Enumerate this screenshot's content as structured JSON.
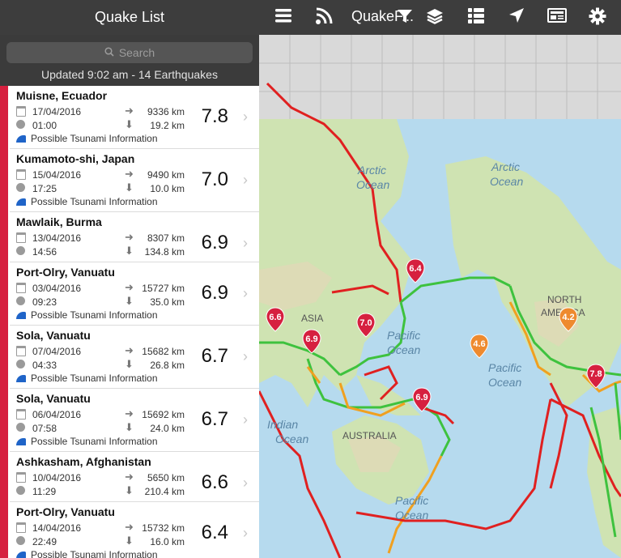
{
  "panel": {
    "title": "Quake List",
    "search_placeholder": "Search",
    "updated": "Updated 9:02 am - 14 Earthquakes"
  },
  "toolbar": {
    "title": "QuakeF...",
    "icons": [
      "menu-icon",
      "rss-icon",
      "filter-icon",
      "layers-icon",
      "list-icon",
      "location-arrow-icon",
      "news-icon",
      "gear-icon"
    ]
  },
  "quakes": [
    {
      "place": "Muisne, Ecuador",
      "date": "17/04/2016",
      "time": "01:00",
      "distance": "9336 km",
      "depth": "19.2 km",
      "magnitude": "7.8",
      "tsunami": "Possible Tsunami Information"
    },
    {
      "place": "Kumamoto-shi, Japan",
      "date": "15/04/2016",
      "time": "17:25",
      "distance": "9490 km",
      "depth": "10.0 km",
      "magnitude": "7.0",
      "tsunami": "Possible Tsunami Information"
    },
    {
      "place": "Mawlaik, Burma",
      "date": "13/04/2016",
      "time": "14:56",
      "distance": "8307 km",
      "depth": "134.8 km",
      "magnitude": "6.9",
      "tsunami": ""
    },
    {
      "place": "Port-Olry, Vanuatu",
      "date": "03/04/2016",
      "time": "09:23",
      "distance": "15727 km",
      "depth": "35.0 km",
      "magnitude": "6.9",
      "tsunami": "Possible Tsunami Information"
    },
    {
      "place": "Sola, Vanuatu",
      "date": "07/04/2016",
      "time": "04:33",
      "distance": "15682 km",
      "depth": "26.8 km",
      "magnitude": "6.7",
      "tsunami": "Possible Tsunami Information"
    },
    {
      "place": "Sola, Vanuatu",
      "date": "06/04/2016",
      "time": "07:58",
      "distance": "15692 km",
      "depth": "24.0 km",
      "magnitude": "6.7",
      "tsunami": "Possible Tsunami Information"
    },
    {
      "place": "Ashkasham, Afghanistan",
      "date": "10/04/2016",
      "time": "11:29",
      "distance": "5650 km",
      "depth": "210.4 km",
      "magnitude": "6.6",
      "tsunami": ""
    },
    {
      "place": "Port-Olry, Vanuatu",
      "date": "14/04/2016",
      "time": "22:49",
      "distance": "15732 km",
      "depth": "16.0 km",
      "magnitude": "6.4",
      "tsunami": "Possible Tsunami Information"
    }
  ],
  "map": {
    "labels": {
      "arctic1": "Arctic",
      "arctic1b": "Ocean",
      "arctic2": "Arctic",
      "arctic2b": "Ocean",
      "asia": "ASIA",
      "pacific1": "Pacific",
      "pacific1b": "Ocean",
      "pacific2": "Pacific",
      "pacific2b": "Ocean",
      "pacific3": "Pacific",
      "pacific3b": "Ocean",
      "indian": "Indian",
      "indianb": "Ocean",
      "australia": "AUSTRALIA",
      "north": "NORTH",
      "america": "AMERICA"
    },
    "pins": [
      {
        "mag": "6.4",
        "color": "#d6203f"
      },
      {
        "mag": "6.6",
        "color": "#d6203f"
      },
      {
        "mag": "7.0",
        "color": "#d6203f"
      },
      {
        "mag": "6.9",
        "color": "#d6203f"
      },
      {
        "mag": "4.6",
        "color": "#ee8a2f"
      },
      {
        "mag": "4.2",
        "color": "#ee8a2f"
      },
      {
        "mag": "6.9",
        "color": "#d6203f"
      },
      {
        "mag": "7.8",
        "color": "#d6203f"
      }
    ]
  }
}
